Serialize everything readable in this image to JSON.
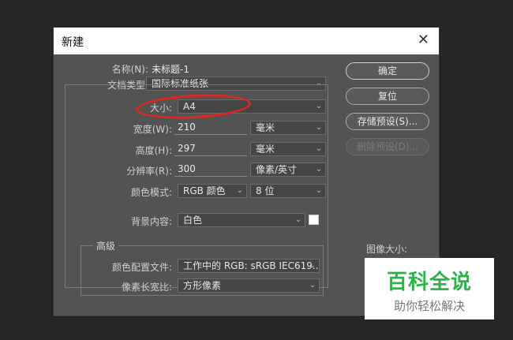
{
  "dialog": {
    "title": "新建",
    "close_glyph": "✕"
  },
  "form": {
    "name_label": "名称(N):",
    "name_value": "未标题-1",
    "doc_type_label": "文档类型:",
    "doc_type_value": "国际标准纸张",
    "size_label": "大小:",
    "size_value": "A4",
    "width_label": "宽度(W):",
    "width_value": "210",
    "width_unit": "毫米",
    "height_label": "高度(H):",
    "height_value": "297",
    "height_unit": "毫米",
    "resolution_label": "分辨率(R):",
    "resolution_value": "300",
    "resolution_unit": "像素/英寸",
    "color_mode_label": "颜色模式:",
    "color_mode_value": "RGB 颜色",
    "bit_depth_value": "8 位",
    "background_label": "背景内容:",
    "background_value": "白色",
    "background_swatch": "#ffffff"
  },
  "advanced": {
    "legend": "高级",
    "color_profile_label": "颜色配置文件:",
    "color_profile_value": "工作中的 RGB: sRGB IEC619...",
    "pixel_aspect_label": "像素长宽比:",
    "pixel_aspect_value": "方形像素"
  },
  "buttons": {
    "ok": "确定",
    "reset": "复位",
    "save_preset": "存储预设(S)...",
    "delete_preset": "删除预设(D)..."
  },
  "image_size_label": "图像大小:",
  "watermark": {
    "main": "百科全说",
    "sub": "助你轻松解决"
  },
  "colors": {
    "annotation_ring": "#e0261f",
    "watermark_green": "#2db34a"
  }
}
